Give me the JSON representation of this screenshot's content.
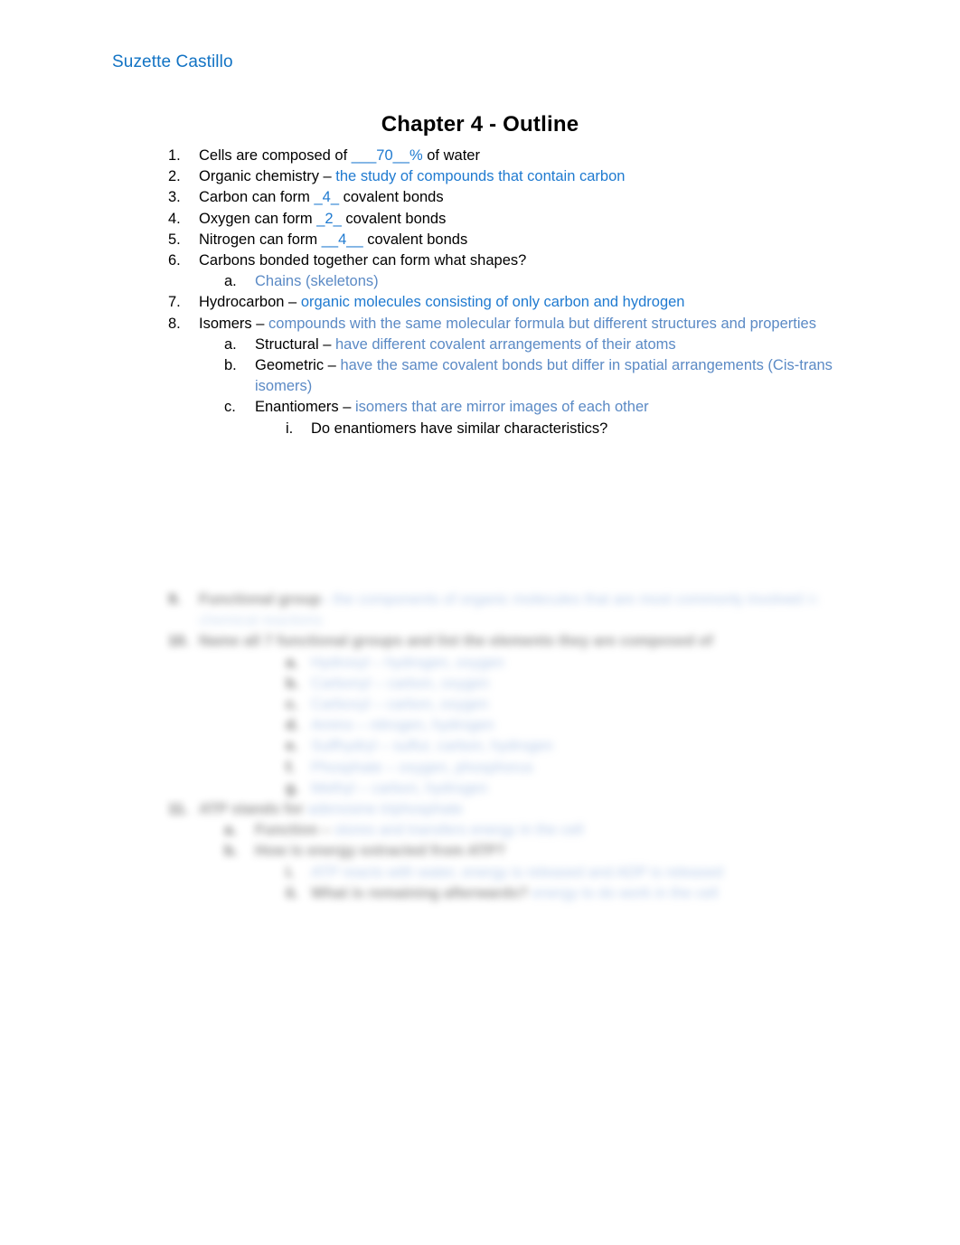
{
  "document": {
    "author_header": "Suzette Castillo",
    "title": "Chapter 4 - Outline",
    "colors": {
      "header_blue": "#1273c4",
      "answer_blue_strong": "#1f7ad0",
      "answer_blue_soft": "#5b8ac5",
      "body_black": "#000000",
      "page_background": "#ffffff"
    }
  },
  "outline": {
    "items": [
      {
        "marker": "1.",
        "level": 1,
        "prompt": "Cells are composed of ",
        "answer": "___70__%",
        "answer_style": "strong",
        "suffix": " of water"
      },
      {
        "marker": "2.",
        "level": 1,
        "prompt": "Organic chemistry – ",
        "answer": "the study of compounds that contain carbon",
        "answer_style": "strong",
        "suffix": ""
      },
      {
        "marker": "3.",
        "level": 1,
        "prompt": "Carbon can form ",
        "answer": "_4_",
        "answer_style": "strong",
        "suffix": " covalent bonds"
      },
      {
        "marker": "4.",
        "level": 1,
        "prompt": "Oxygen can form ",
        "answer": "_2_",
        "answer_style": "strong",
        "suffix": " covalent bonds"
      },
      {
        "marker": "5.",
        "level": 1,
        "prompt": "Nitrogen can form ",
        "answer": "__4__",
        "answer_style": "strong",
        "suffix": " covalent bonds"
      },
      {
        "marker": "6.",
        "level": 1,
        "prompt": "Carbons bonded together can form what shapes?",
        "answer": "",
        "answer_style": "none",
        "suffix": ""
      },
      {
        "marker": "a.",
        "level": 2,
        "prompt": "",
        "answer": "Chains (skeletons)",
        "answer_style": "soft",
        "suffix": ""
      },
      {
        "marker": "7.",
        "level": 1,
        "prompt": "Hydrocarbon – ",
        "answer": "organic molecules consisting of only carbon and hydrogen",
        "answer_style": "strong",
        "suffix": ""
      },
      {
        "marker": "8.",
        "level": 1,
        "prompt": "Isomers –  ",
        "answer": "compounds with the same molecular formula but different structures and properties",
        "answer_style": "soft",
        "suffix": ""
      },
      {
        "marker": "a.",
        "level": 2,
        "prompt": "Structural – ",
        "answer": "have different covalent arrangements of their atoms",
        "answer_style": "soft",
        "suffix": ""
      },
      {
        "marker": "b.",
        "level": 2,
        "prompt": "Geometric – ",
        "answer": "have the same covalent bonds but differ in spatial arrangements (Cis-trans isomers)",
        "answer_style": "soft",
        "suffix": ""
      },
      {
        "marker": "c.",
        "level": 2,
        "prompt": "Enantiomers – ",
        "answer": "isomers that are mirror images of each other",
        "answer_style": "soft",
        "suffix": ""
      },
      {
        "marker": "i.",
        "level": 3,
        "prompt": "Do enantiomers have similar characteristics?",
        "answer": "",
        "answer_style": "none",
        "suffix": ""
      }
    ]
  },
  "obscured_section": {
    "note": "Lower portion of the page is heavily blurred and illegible.",
    "lines": [
      {
        "level": 1,
        "marker": "9.",
        "dark": "Functional group",
        "blue": "– the components of organic molecules that are most commonly involved",
        "wrap": "in chemical reactions"
      },
      {
        "level": 1,
        "marker": "10.",
        "dark": "Name all 7 functional groups and list the elements they are composed of",
        "blue": "",
        "wrap": ""
      },
      {
        "level": 3,
        "marker": "a.",
        "dark": "",
        "blue": "Hydroxyl – hydrogen, oxygen",
        "wrap": ""
      },
      {
        "level": 3,
        "marker": "b.",
        "dark": "",
        "blue": "Carbonyl – carbon, oxygen",
        "wrap": ""
      },
      {
        "level": 3,
        "marker": "c.",
        "dark": "",
        "blue": "Carboxyl – carbon, oxygen",
        "wrap": ""
      },
      {
        "level": 3,
        "marker": "d.",
        "dark": "",
        "blue": "Amino – nitrogen, hydrogen",
        "wrap": ""
      },
      {
        "level": 3,
        "marker": "e.",
        "dark": "",
        "blue": "Sulfhydryl – sulfur, carbon, hydrogen",
        "wrap": ""
      },
      {
        "level": 3,
        "marker": "f.",
        "dark": "",
        "blue": "Phosphate – oxygen, phosphorus",
        "wrap": ""
      },
      {
        "level": 3,
        "marker": "g.",
        "dark": "",
        "blue": "Methyl – carbon, hydrogen",
        "wrap": ""
      },
      {
        "level": 1,
        "marker": "11.",
        "dark": "ATP stands for",
        "blue": " adenosine triphosphate",
        "wrap": ""
      },
      {
        "level": 2,
        "marker": "a.",
        "dark": "Function –",
        "blue": " stores and transfers energy in the cell",
        "wrap": ""
      },
      {
        "level": 2,
        "marker": "b.",
        "dark": "How is energy extracted from ATP?",
        "blue": "",
        "wrap": ""
      },
      {
        "level": 3,
        "marker": "i.",
        "dark": "",
        "blue": "ATP reacts with water, energy is released and ADP is released",
        "wrap": ""
      },
      {
        "level": 3,
        "marker": "ii.",
        "dark": "What is remaining afterwards?",
        "blue": " energy to do work in the cell",
        "wrap": ""
      }
    ]
  }
}
